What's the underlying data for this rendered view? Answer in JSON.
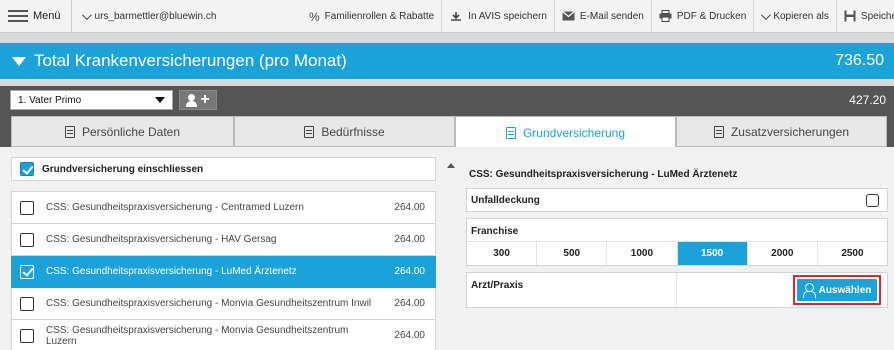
{
  "toolbar": {
    "menu_label": "Menü",
    "user_label": "urs_barmettler@bluewin.ch",
    "items": [
      {
        "icon": "percent-icon",
        "label": "Familienrollen & Rabatte"
      },
      {
        "icon": "save-cloud-icon",
        "label": "In AVIS speichern"
      },
      {
        "icon": "envelope-icon",
        "label": "E-Mail senden"
      },
      {
        "icon": "printer-icon",
        "label": "PDF & Drucken"
      },
      {
        "icon": "chevron-down-icon",
        "label": "Kopieren als"
      },
      {
        "icon": "disk-icon",
        "label": "Speiche"
      }
    ]
  },
  "title_bar": {
    "title": "Total Krankenversicherungen (pro Monat)",
    "total": "736.50"
  },
  "person_bar": {
    "selected_person": "1. Vater Primo",
    "amount": "427.20"
  },
  "tabs": [
    {
      "label": "Persönliche Daten",
      "active": false
    },
    {
      "label": "Bedürfnisse",
      "active": false
    },
    {
      "label": "Grundversicherung",
      "active": true
    },
    {
      "label": "Zusatzversicherungen",
      "active": false
    }
  ],
  "left_panel": {
    "include_label": "Grundversicherung einschliessen",
    "include_checked": true,
    "products": [
      {
        "name": "CSS: Gesundheitspraxisversicherung - Centramed Luzern",
        "price": "264.00",
        "checked": false,
        "selected": false
      },
      {
        "name": "CSS: Gesundheitspraxisversicherung - HAV Gersag",
        "price": "264.00",
        "checked": false,
        "selected": false
      },
      {
        "name": "CSS: Gesundheitspraxisversicherung - LuMed Ärztenetz",
        "price": "264.00",
        "checked": true,
        "selected": true
      },
      {
        "name": "CSS: Gesundheitspraxisversicherung - Monvia Gesundheitszentrum Inwil",
        "price": "264.00",
        "checked": false,
        "selected": false
      },
      {
        "name": "CSS: Gesundheitspraxisversicherung - Monvia Gesundheitszentrum Luzern",
        "price": "264.00",
        "checked": false,
        "selected": false
      }
    ]
  },
  "right_panel": {
    "title": "CSS: Gesundheitspraxisversicherung - LuMed Ärztenetz",
    "unfall_label": "Unfalldeckung",
    "unfall_checked": false,
    "franchise_label": "Franchise",
    "franchise_options": [
      "300",
      "500",
      "1000",
      "1500",
      "2000",
      "2500"
    ],
    "franchise_selected": "1500",
    "arzt_label": "Arzt/Praxis",
    "arzt_value": "",
    "select_button_label": "Auswählen"
  },
  "colors": {
    "accent": "#1ba3d9",
    "dark_bar": "#555555",
    "highlight": "#e0262b"
  }
}
